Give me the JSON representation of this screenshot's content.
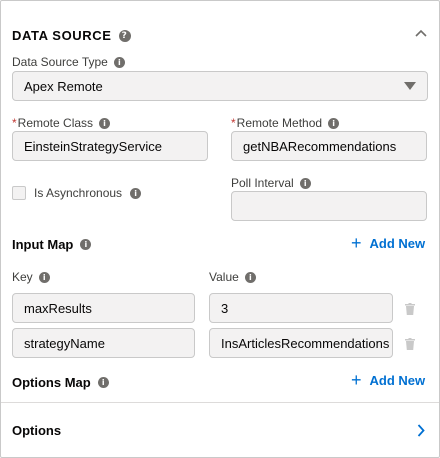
{
  "data_source": {
    "title": "DATA SOURCE",
    "type_label": "Data Source Type",
    "type_value": "Apex Remote",
    "remote_class_label": "Remote Class",
    "remote_class_value": "EinsteinStrategyService",
    "remote_method_label": "Remote Method",
    "remote_method_value": "getNBARecommendations",
    "is_async_label": "Is Asynchronous",
    "is_async_checked": false,
    "poll_interval_label": "Poll Interval",
    "poll_interval_value": ""
  },
  "input_map": {
    "title": "Input Map",
    "add_new_label": "Add New",
    "key_label": "Key",
    "value_label": "Value",
    "rows": [
      {
        "key": "maxResults",
        "value": "3"
      },
      {
        "key": "strategyName",
        "value": "InsArticlesRecommendations"
      }
    ]
  },
  "options_map": {
    "title": "Options Map",
    "add_new_label": "Add New"
  },
  "options": {
    "title": "Options"
  },
  "colors": {
    "accent": "#0070d2",
    "required": "#c23934",
    "border": "#c9c9c9",
    "field_bg": "#f3f2f2"
  }
}
